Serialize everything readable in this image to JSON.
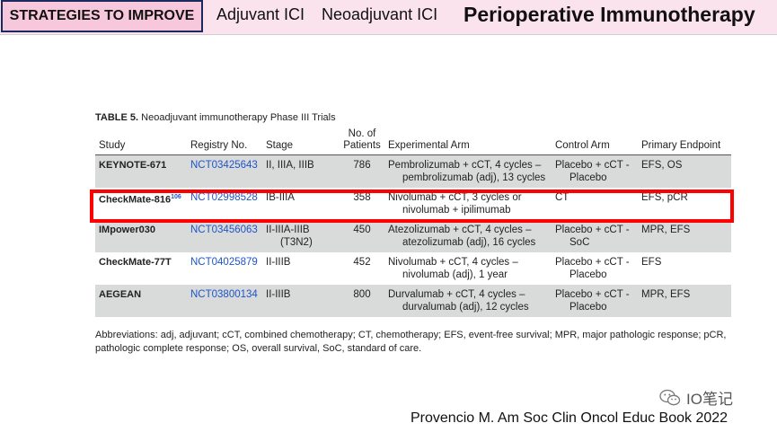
{
  "header": {
    "tab_label": "STRATEGIES TO IMPROVE",
    "nav_items": [
      "Adjuvant ICI",
      "Neoadjuvant ICI"
    ],
    "title": "Perioperative Immunotherapy",
    "colors": {
      "bar": "#fbe3ee",
      "tab": "#f7c8dc",
      "tab_border": "#1a2a5e"
    }
  },
  "table": {
    "caption_label": "TABLE 5.",
    "caption_text": "Neoadjuvant immunotherapy Phase III Trials",
    "columns": {
      "study": "Study",
      "registry": "Registry No.",
      "stage": "Stage",
      "patients_line1": "No. of",
      "patients_line2": "Patients",
      "experimental": "Experimental Arm",
      "control": "Control Arm",
      "endpoint": "Primary Endpoint"
    },
    "rows": [
      {
        "study": "KEYNOTE-671",
        "ref": "",
        "registry": "NCT03425643",
        "stage": "II, IIIA, IIIB",
        "stage2": "",
        "patients": "786",
        "exp1": "Pembrolizumab + cCT, 4 cycles –",
        "exp2": "pembrolizumab (adj), 13 cycles",
        "ctrl1": "Placebo + cCT -",
        "ctrl2": "Placebo",
        "endpoint": "EFS, OS"
      },
      {
        "study": "CheckMate-816",
        "ref": "106",
        "registry": "NCT02998528",
        "stage": "IB-IIIA",
        "stage2": "",
        "patients": "358",
        "exp1": "Nivolumab + cCT, 3 cycles or",
        "exp2": "nivolumab + ipilimumab",
        "ctrl1": "CT",
        "ctrl2": "",
        "endpoint": "EFS, pCR"
      },
      {
        "study": "IMpower030",
        "ref": "",
        "registry": "NCT03456063",
        "stage": "II-IIIA-IIIB",
        "stage2": "(T3N2)",
        "patients": "450",
        "exp1": "Atezolizumab + cCT, 4 cycles –",
        "exp2": "atezolizumab (adj), 16 cycles",
        "ctrl1": "Placebo + cCT -",
        "ctrl2": "SoC",
        "endpoint": "MPR, EFS"
      },
      {
        "study": "CheckMate-77T",
        "ref": "",
        "registry": "NCT04025879",
        "stage": "II-IIIB",
        "stage2": "",
        "patients": "452",
        "exp1": "Nivolumab + cCT, 4 cycles –",
        "exp2": "nivolumab (adj), 1 year",
        "ctrl1": "Placebo + cCT -",
        "ctrl2": "Placebo",
        "endpoint": "EFS"
      },
      {
        "study": "AEGEAN",
        "ref": "",
        "registry": "NCT03800134",
        "stage": "II-IIIB",
        "stage2": "",
        "patients": "800",
        "exp1": "Durvalumab + cCT, 4 cycles –",
        "exp2": "durvalumab (adj), 12 cycles",
        "ctrl1": "Placebo + cCT -",
        "ctrl2": "Placebo",
        "endpoint": "MPR, EFS"
      }
    ],
    "highlight_color": "#ff0000",
    "registry_link_color": "#1d55c9",
    "row_shade_color": "#d9dada"
  },
  "abbreviations": "Abbreviations: adj, adjuvant; cCT, combined chemotherapy; CT, chemotherapy; EFS, event-free survival; MPR, major pathologic response; pCR, pathologic complete response; OS, overall survival, SoC, standard of care.",
  "watermark": {
    "icon": "wechat-icon",
    "text": "IO笔记"
  },
  "citation": "Provencio M. Am Soc Clin Oncol Educ Book 2022"
}
